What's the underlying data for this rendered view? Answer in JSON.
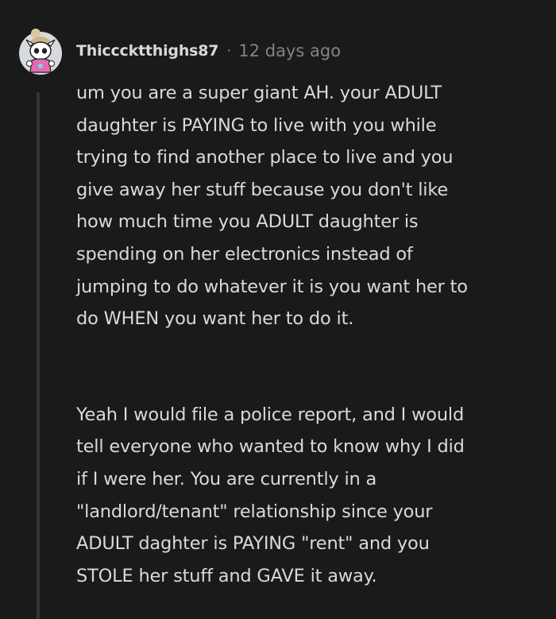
{
  "comment": {
    "author": "Thicccktthighs87",
    "separator": "·",
    "timestamp": "12 days ago",
    "avatar_icon": "snoo-avatar-icon",
    "paragraphs": [
      "um you are a super giant AH. your ADULT\ndaughter is PAYING to live with you while\ntrying to find another place to live and you\ngive away her stuff because you don't like\nhow much time you ADULT daughter is\nspending on her electronics instead of\njumping to do whatever it is you want her to\ndo WHEN you want her to do it.",
      "Yeah I would file a police report, and I would\ntell everyone who wanted to know why I did\nif I were her. You are currently in a\n\"landlord/tenant\" relationship since your\nADULT daghter is PAYING \"rent\" and you\nSTOLE her stuff and GAVE it away."
    ]
  },
  "colors": {
    "background": "#1a1a1b",
    "text": "#d7dadc",
    "meta": "#818384",
    "thread_line": "#343536"
  }
}
